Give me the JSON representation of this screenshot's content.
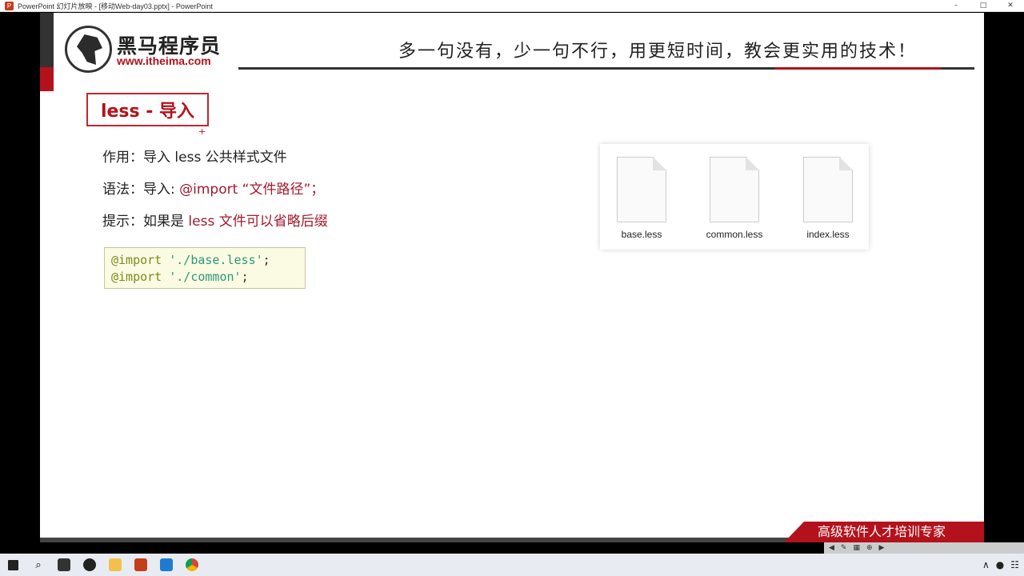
{
  "window": {
    "title": "PowerPoint 幻灯片放映 - [移动Web-day03.pptx] - PowerPoint",
    "app_icon": "P",
    "controls": [
      "–",
      "□",
      "✕"
    ]
  },
  "header": {
    "brand_cn": "黑马程序员",
    "brand_url": "www.itheima.com",
    "slogan": "多一句没有，少一句不行，用更短时间，教会更实用的技术！"
  },
  "slide": {
    "title": "less - 导入",
    "bullets": [
      {
        "label": "作用：",
        "text": "导入 less 公共样式文件",
        "highlight": ""
      },
      {
        "label": "语法：",
        "text": "导入: ",
        "highlight": "@import “文件路径”；"
      },
      {
        "label": "提示：",
        "text": "如果是 ",
        "highlight": "less 文件可以省略后缀"
      }
    ],
    "code": [
      {
        "kw": "@import",
        "str": "'./base.less'",
        "punc": ";"
      },
      {
        "kw": "@import",
        "str": "'./common'",
        "punc": ";"
      }
    ],
    "files": [
      "base.less",
      "common.less",
      "index.less"
    ],
    "footer_text": "高级软件人才培训专家"
  },
  "taskbar": {
    "items": [
      "windows-start",
      "search",
      "typora",
      "github",
      "file-explorer",
      "powerpoint",
      "vscode",
      "chrome"
    ],
    "tray": [
      "∧",
      "●",
      "☷"
    ]
  },
  "colors": {
    "brand_red": "#b3121c",
    "highlight": "#a11a2c",
    "code_bg": "#fbfae3"
  }
}
